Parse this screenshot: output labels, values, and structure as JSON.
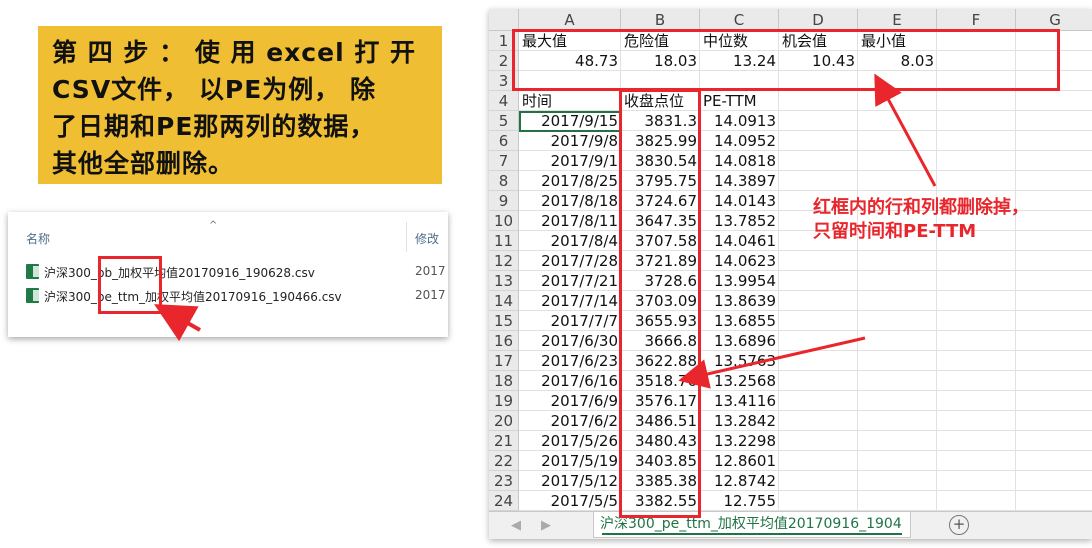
{
  "instruction": {
    "lines": [
      "第 四 步 ： 使 用 excel 打 开",
      "CSV文件， 以PE为例， 除",
      "了日期和PE那两列的数据，",
      "其他全部删除。"
    ]
  },
  "file_explorer": {
    "col_name": "名称",
    "col_modified": "修改",
    "sort_glyph": "^",
    "files": [
      {
        "name": "沪深300_pb_加权平均值20170916_190628.csv",
        "date": "2017"
      },
      {
        "name": "沪深300_pe_ttm_加权平均值20170916_190466.csv",
        "date": "2017"
      }
    ]
  },
  "excel": {
    "columns": [
      "A",
      "B",
      "C",
      "D",
      "E",
      "F",
      "G"
    ],
    "rows": [
      {
        "num": "1",
        "cells": [
          {
            "v": "最大值",
            "t": "txt"
          },
          {
            "v": "危险值",
            "t": "txt"
          },
          {
            "v": "中位数",
            "t": "txt"
          },
          {
            "v": "机会值",
            "t": "txt"
          },
          {
            "v": "最小值",
            "t": "txt"
          }
        ]
      },
      {
        "num": "2",
        "cells": [
          {
            "v": "48.73",
            "t": "num"
          },
          {
            "v": "18.03",
            "t": "num"
          },
          {
            "v": "13.24",
            "t": "num"
          },
          {
            "v": "10.43",
            "t": "num"
          },
          {
            "v": "8.03",
            "t": "num"
          }
        ]
      },
      {
        "num": "3",
        "cells": []
      },
      {
        "num": "4",
        "cells": [
          {
            "v": "时间",
            "t": "txt"
          },
          {
            "v": "收盘点位",
            "t": "txt"
          },
          {
            "v": "PE-TTM",
            "t": "txt"
          }
        ]
      },
      {
        "num": "5",
        "cells": [
          {
            "v": "2017/9/15",
            "t": "num"
          },
          {
            "v": "3831.3",
            "t": "num"
          },
          {
            "v": "14.0913",
            "t": "num"
          }
        ]
      },
      {
        "num": "6",
        "cells": [
          {
            "v": "2017/9/8",
            "t": "num"
          },
          {
            "v": "3825.99",
            "t": "num"
          },
          {
            "v": "14.0952",
            "t": "num"
          }
        ]
      },
      {
        "num": "7",
        "cells": [
          {
            "v": "2017/9/1",
            "t": "num"
          },
          {
            "v": "3830.54",
            "t": "num"
          },
          {
            "v": "14.0818",
            "t": "num"
          }
        ]
      },
      {
        "num": "8",
        "cells": [
          {
            "v": "2017/8/25",
            "t": "num"
          },
          {
            "v": "3795.75",
            "t": "num"
          },
          {
            "v": "14.3897",
            "t": "num"
          }
        ]
      },
      {
        "num": "9",
        "cells": [
          {
            "v": "2017/8/18",
            "t": "num"
          },
          {
            "v": "3724.67",
            "t": "num"
          },
          {
            "v": "14.0143",
            "t": "num"
          }
        ]
      },
      {
        "num": "10",
        "cells": [
          {
            "v": "2017/8/11",
            "t": "num"
          },
          {
            "v": "3647.35",
            "t": "num"
          },
          {
            "v": "13.7852",
            "t": "num"
          }
        ]
      },
      {
        "num": "11",
        "cells": [
          {
            "v": "2017/8/4",
            "t": "num"
          },
          {
            "v": "3707.58",
            "t": "num"
          },
          {
            "v": "14.0461",
            "t": "num"
          }
        ]
      },
      {
        "num": "12",
        "cells": [
          {
            "v": "2017/7/28",
            "t": "num"
          },
          {
            "v": "3721.89",
            "t": "num"
          },
          {
            "v": "14.0623",
            "t": "num"
          }
        ]
      },
      {
        "num": "13",
        "cells": [
          {
            "v": "2017/7/21",
            "t": "num"
          },
          {
            "v": "3728.6",
            "t": "num"
          },
          {
            "v": "13.9954",
            "t": "num"
          }
        ]
      },
      {
        "num": "14",
        "cells": [
          {
            "v": "2017/7/14",
            "t": "num"
          },
          {
            "v": "3703.09",
            "t": "num"
          },
          {
            "v": "13.8639",
            "t": "num"
          }
        ]
      },
      {
        "num": "15",
        "cells": [
          {
            "v": "2017/7/7",
            "t": "num"
          },
          {
            "v": "3655.93",
            "t": "num"
          },
          {
            "v": "13.6855",
            "t": "num"
          }
        ]
      },
      {
        "num": "16",
        "cells": [
          {
            "v": "2017/6/30",
            "t": "num"
          },
          {
            "v": "3666.8",
            "t": "num"
          },
          {
            "v": "13.6896",
            "t": "num"
          }
        ]
      },
      {
        "num": "17",
        "cells": [
          {
            "v": "2017/6/23",
            "t": "num"
          },
          {
            "v": "3622.88",
            "t": "num"
          },
          {
            "v": "13.5763",
            "t": "num"
          }
        ]
      },
      {
        "num": "18",
        "cells": [
          {
            "v": "2017/6/16",
            "t": "num"
          },
          {
            "v": "3518.76",
            "t": "num"
          },
          {
            "v": "13.2568",
            "t": "num"
          }
        ]
      },
      {
        "num": "19",
        "cells": [
          {
            "v": "2017/6/9",
            "t": "num"
          },
          {
            "v": "3576.17",
            "t": "num"
          },
          {
            "v": "13.4116",
            "t": "num"
          }
        ]
      },
      {
        "num": "20",
        "cells": [
          {
            "v": "2017/6/2",
            "t": "num"
          },
          {
            "v": "3486.51",
            "t": "num"
          },
          {
            "v": "13.2842",
            "t": "num"
          }
        ]
      },
      {
        "num": "21",
        "cells": [
          {
            "v": "2017/5/26",
            "t": "num"
          },
          {
            "v": "3480.43",
            "t": "num"
          },
          {
            "v": "13.2298",
            "t": "num"
          }
        ]
      },
      {
        "num": "22",
        "cells": [
          {
            "v": "2017/5/19",
            "t": "num"
          },
          {
            "v": "3403.85",
            "t": "num"
          },
          {
            "v": "12.8601",
            "t": "num"
          }
        ]
      },
      {
        "num": "23",
        "cells": [
          {
            "v": "2017/5/12",
            "t": "num"
          },
          {
            "v": "3385.38",
            "t": "num"
          },
          {
            "v": "12.8742",
            "t": "num"
          }
        ]
      },
      {
        "num": "24",
        "cells": [
          {
            "v": "2017/5/5",
            "t": "num"
          },
          {
            "v": "3382.55",
            "t": "num"
          },
          {
            "v": "12.755",
            "t": "num"
          }
        ]
      }
    ],
    "sheet_tab": "沪深300_pe_ttm_加权平均值20170916_1904",
    "nav_left": "◀",
    "nav_right": "▶",
    "add_sheet": "+"
  },
  "annotation": {
    "lines": [
      "红框内的行和列都删除掉，",
      "只留时间和PE-TTM"
    ]
  },
  "colors": {
    "highlight": "#efbe33",
    "annotation_red": "#e8262c",
    "excel_green": "#217346"
  }
}
